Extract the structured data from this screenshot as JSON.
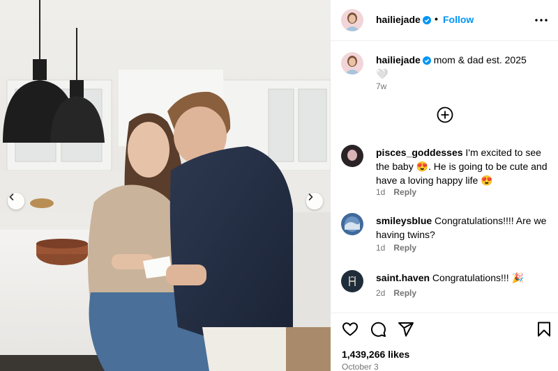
{
  "post": {
    "author": "hailiejade",
    "follow_label": "Follow",
    "header_separator": "•",
    "caption_text": "mom & dad est. 2025",
    "caption_emoji": "🤍",
    "caption_time": "7w",
    "likes": "1,439,266 likes",
    "date": "October 3"
  },
  "comments": [
    {
      "user": "pisces_goddesses",
      "text": "I'm excited to see the baby 😍. He is going to be cute and have a loving happy life 😍",
      "time": "1d",
      "reply": "Reply"
    },
    {
      "user": "smileysblue",
      "text": "Congratulations!!!! Are we having twins?",
      "time": "1d",
      "reply": "Reply"
    },
    {
      "user": "saint.haven",
      "text": "Congratulations!!! 🎉",
      "time": "2d",
      "reply": "Reply"
    }
  ],
  "icons": {
    "more": "more-options-icon",
    "verified": "verified-badge-icon",
    "load_more": "plus-circle-icon",
    "like": "heart-icon",
    "comment": "comment-icon",
    "share": "share-icon",
    "save": "bookmark-icon",
    "prev": "chevron-left-icon",
    "next": "chevron-right-icon"
  },
  "colors": {
    "accent": "#0095f6",
    "secondary_text": "#737373",
    "verified": "#0095f6"
  }
}
